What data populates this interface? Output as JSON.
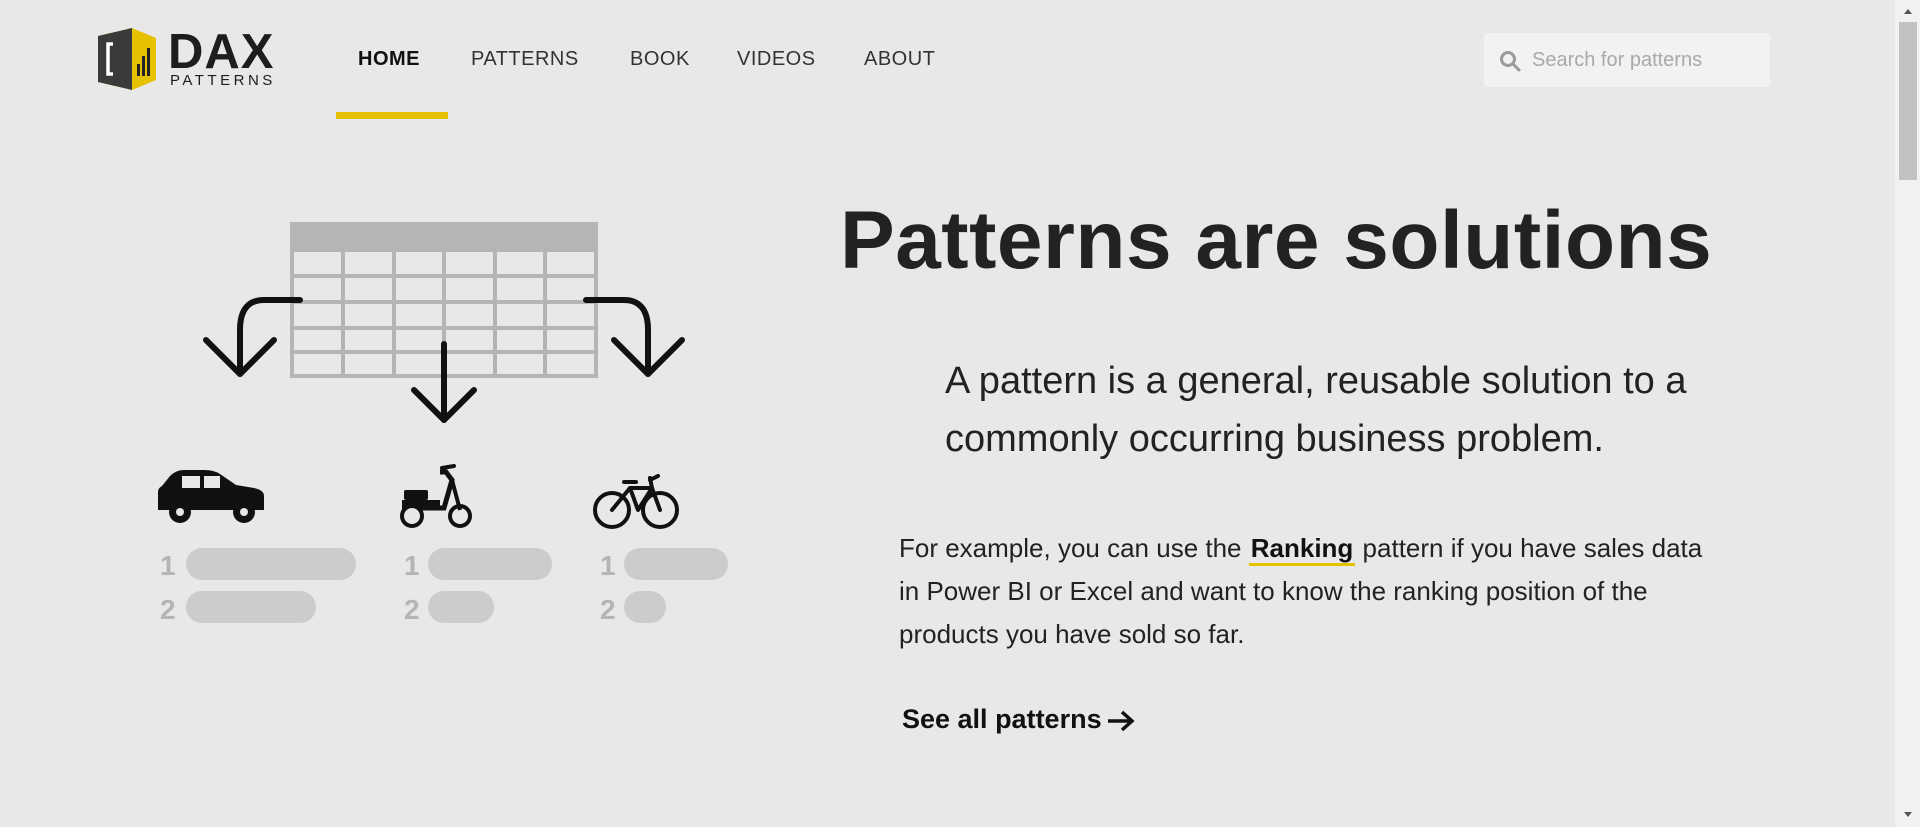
{
  "brand": {
    "name": "DAX",
    "sub": "PATTERNS",
    "accent": "#e6c100"
  },
  "nav": {
    "items": [
      {
        "label": "HOME",
        "active": true
      },
      {
        "label": "PATTERNS"
      },
      {
        "label": "BOOK"
      },
      {
        "label": "VIDEOS"
      },
      {
        "label": "ABOUT"
      }
    ]
  },
  "search": {
    "placeholder": "Search for patterns",
    "icon": "search-icon"
  },
  "illustration": {
    "icons": [
      "table-icon",
      "car-icon",
      "scooter-icon",
      "bicycle-icon"
    ],
    "ranks": [
      "1",
      "2"
    ]
  },
  "hero": {
    "title": "Patterns are solutions",
    "lead": "A pattern is a general, reusable solution to a commonly occurring business problem.",
    "body_before": "For example, you can use the ",
    "body_link": "Ranking",
    "body_after": " pattern if you have sales data in Power BI or Excel and want to know the ranking position of the products you have sold so far.",
    "cta": "See all patterns"
  }
}
